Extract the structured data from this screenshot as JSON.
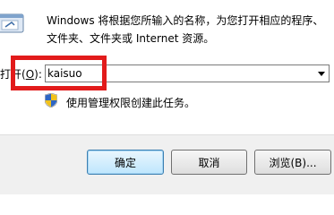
{
  "description": {
    "line1": "Windows 将根据您所输入的名称，为您打开相应的程序、",
    "line2": "文件夹、文件夹或 Internet 资源。"
  },
  "open_field": {
    "label_prefix": "打开(",
    "label_mnemonic": "O",
    "label_suffix": "):",
    "value": "kaisuo"
  },
  "admin_note": "使用管理权限创建此任务。",
  "buttons": {
    "ok": "确定",
    "cancel": "取消",
    "browse": "浏览(B)..."
  },
  "colors": {
    "highlight": "#e21b1b"
  },
  "icons": {
    "run": "run-program-icon",
    "shield": "uac-shield-icon",
    "dropdown": "chevron-down-icon"
  }
}
